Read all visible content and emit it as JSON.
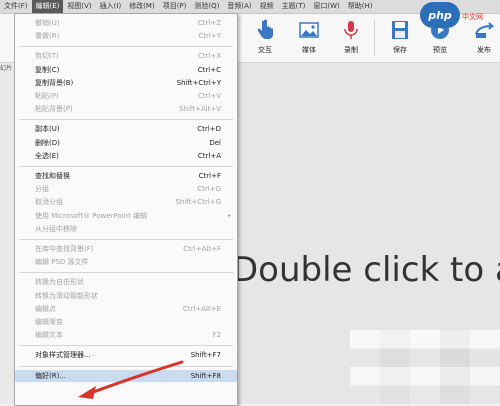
{
  "menubar": {
    "items": [
      {
        "label": "文件(F)"
      },
      {
        "label": "编辑(E)",
        "active": true
      },
      {
        "label": "视图(V)"
      },
      {
        "label": "插入(I)"
      },
      {
        "label": "修改(M)"
      },
      {
        "label": "项目(P)"
      },
      {
        "label": "测验(Q)"
      },
      {
        "label": "音频(A)"
      },
      {
        "label": "视频"
      },
      {
        "label": "主题(T)"
      },
      {
        "label": "窗口(W)"
      },
      {
        "label": "帮助(H)"
      }
    ]
  },
  "toolbar": {
    "buttons": [
      {
        "label": "交互",
        "icon": "pointer-hand-icon"
      },
      {
        "label": "媒体",
        "icon": "image-icon"
      },
      {
        "label": "录制",
        "icon": "microphone-icon"
      },
      {
        "label": "保存",
        "icon": "floppy-disk-icon"
      },
      {
        "label": "预览",
        "icon": "play-icon"
      },
      {
        "label": "发布",
        "icon": "publish-icon"
      }
    ]
  },
  "left_strip": {
    "label": "幻片"
  },
  "logo": {
    "text": "php",
    "sub": "中文网"
  },
  "slide": {
    "text": "Double click to a"
  },
  "menu": {
    "items": [
      {
        "label": "撤销(U)",
        "shortcut": "Ctrl+Z",
        "disabled": true
      },
      {
        "label": "重做(R)",
        "shortcut": "Ctrl+Y",
        "disabled": true
      },
      {
        "sep": true
      },
      {
        "label": "剪切(T)",
        "shortcut": "Ctrl+X",
        "disabled": true
      },
      {
        "label": "复制(C)",
        "shortcut": "Ctrl+C"
      },
      {
        "label": "复制背景(B)",
        "shortcut": "Shift+Ctrl+Y"
      },
      {
        "label": "粘贴(P)",
        "shortcut": "Ctrl+V",
        "disabled": true
      },
      {
        "label": "粘贴背景(P)",
        "shortcut": "Shift+Alt+V",
        "disabled": true
      },
      {
        "sep": true
      },
      {
        "label": "副本(U)",
        "shortcut": "Ctrl+D"
      },
      {
        "label": "删除(D)",
        "shortcut": "Del"
      },
      {
        "label": "全选(E)",
        "shortcut": "Ctrl+A"
      },
      {
        "sep": true
      },
      {
        "label": "查找和替换",
        "shortcut": "Ctrl+F"
      },
      {
        "label": "分组",
        "shortcut": "Ctrl+G",
        "disabled": true
      },
      {
        "label": "取消分组",
        "shortcut": "Shift+Ctrl+G",
        "disabled": true
      },
      {
        "label": "使用 Microsoft® PowerPoint 编辑",
        "shortcut": "",
        "disabled": true,
        "submenu": true
      },
      {
        "label": "从分组中移除",
        "shortcut": "",
        "disabled": true
      },
      {
        "sep": true
      },
      {
        "label": "在库中查找背景(F)",
        "shortcut": "Ctrl+Alt+F",
        "disabled": true
      },
      {
        "label": "编辑 PSD 源文件",
        "shortcut": "",
        "disabled": true
      },
      {
        "sep": true
      },
      {
        "label": "转换为自由形状",
        "shortcut": "",
        "disabled": true
      },
      {
        "label": "转换为滑动智能形状",
        "shortcut": "",
        "disabled": true
      },
      {
        "label": "编辑点",
        "shortcut": "Ctrl+Alt+E",
        "disabled": true
      },
      {
        "label": "编辑渐变",
        "shortcut": "",
        "disabled": true
      },
      {
        "label": "编辑文本",
        "shortcut": "F2",
        "disabled": true
      },
      {
        "sep": true
      },
      {
        "label": "对象样式管理器...",
        "shortcut": "Shift+F7"
      },
      {
        "sep": true
      },
      {
        "label": "偏好(R)...",
        "shortcut": "Shift+F8",
        "highlight": true
      }
    ]
  },
  "colors": {
    "annotation": "#d9322a",
    "menu_highlight": "#c9dcef"
  }
}
